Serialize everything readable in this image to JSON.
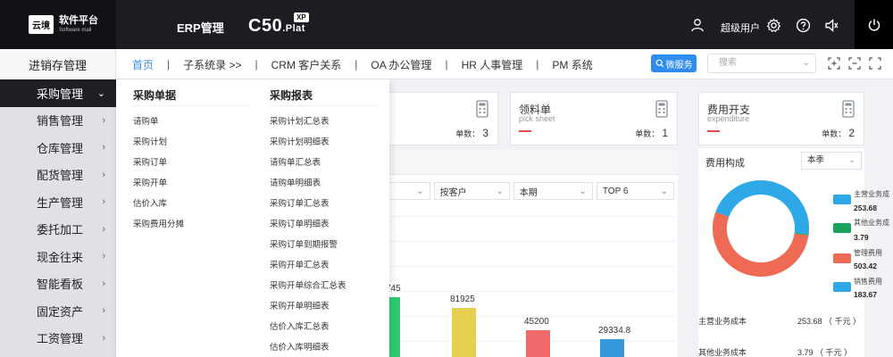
{
  "topbar": {
    "logo_badge": "云境",
    "logo_title": "软件平台",
    "logo_subtitle": "Software mall",
    "erp_label": "ERP管理",
    "product_name": "C50",
    "product_suffix": ".Plat",
    "product_badge": "XP",
    "user_label": "超级用户"
  },
  "nav": {
    "module_title": "进销存管理",
    "tabs": [
      {
        "label": "首页",
        "active": true
      },
      {
        "label": "子系统录 >>"
      },
      {
        "label": "CRM 客户关系"
      },
      {
        "label": "OA 办公管理"
      },
      {
        "label": "HR 人事管理"
      },
      {
        "label": "PM 系统"
      }
    ],
    "service_button": "微服务",
    "search_placeholder": "搜索"
  },
  "sidebar": {
    "items": [
      {
        "label": "采购管理",
        "active": true,
        "arrow": "⌄"
      },
      {
        "label": "销售管理",
        "arrow": "›"
      },
      {
        "label": "仓库管理",
        "arrow": "›"
      },
      {
        "label": "配货管理",
        "arrow": "›"
      },
      {
        "label": "生产管理",
        "arrow": "›"
      },
      {
        "label": "委托加工",
        "arrow": "›"
      },
      {
        "label": "现金往来",
        "arrow": "›"
      },
      {
        "label": "智能看板",
        "arrow": "›"
      },
      {
        "label": "固定资产",
        "arrow": "›"
      },
      {
        "label": "工资管理",
        "arrow": "›"
      }
    ]
  },
  "dropdown": {
    "col1_title": "采购单据",
    "col1_items": [
      "请购单",
      "采购计划",
      "采购订单",
      "采购开单",
      "估价入库",
      "采购费用分摊"
    ],
    "col2_title": "采购报表",
    "col2_items": [
      "采购计划汇总表",
      "采购计划明细表",
      "请购单汇总表",
      "请购单明细表",
      "采购订单汇总表",
      "采购订单明细表",
      "采购订单到期报警",
      "采购开单汇总表",
      "采购开单综合汇总表",
      "采购开单明细表",
      "估价入库汇总表",
      "估价入库明细表"
    ]
  },
  "cards": {
    "first_count_label": "单数：",
    "first_count": "3",
    "pick": {
      "title": "领料单",
      "subtitle": "pick sheet",
      "count_label": "单数：",
      "count": "1"
    },
    "expense": {
      "title": "费用开支",
      "subtitle": "expenditure",
      "count_label": "单数：",
      "count": "2"
    }
  },
  "filters": [
    {
      "label": ""
    },
    {
      "label": "按客户"
    },
    {
      "label": "本期"
    },
    {
      "label": "TOP 6"
    }
  ],
  "chart_data": {
    "type": "bar",
    "values_visible": [
      {
        "label": "745",
        "color": "#2ecc71"
      },
      {
        "label": "81925",
        "value": 81925,
        "color": "#e6cf4f"
      },
      {
        "label": "45200",
        "value": 45200,
        "color": "#ef6a6a"
      },
      {
        "label": "29334.8",
        "value": 29334.8,
        "color": "#3498db"
      }
    ]
  },
  "cost_panel": {
    "title": "费用构成",
    "period": "本季",
    "legend": [
      {
        "name": "主营业务成",
        "value": "253.68",
        "color": "#2ea8e6"
      },
      {
        "name": "其他业务成",
        "value": "3.79",
        "color": "#1aa35a"
      },
      {
        "name": "管理费用",
        "value": "503.42",
        "color": "#ef6a55"
      },
      {
        "name": "销售费用",
        "value": "183.67",
        "color": "#2ea8e6"
      }
    ],
    "donut": [
      {
        "name": "主营业务成本",
        "value": 253.68,
        "color": "#2ea8e6"
      },
      {
        "name": "其他业务成本",
        "value": 3.79,
        "color": "#1aa35a"
      },
      {
        "name": "管理费用",
        "value": 503.42,
        "color": "#ef6a55"
      },
      {
        "name": "销售费用",
        "value": 183.67,
        "color": "#2ea8e6"
      }
    ],
    "summary": [
      {
        "name": "主营业务成本",
        "value": "253.68 （ 千元 ）"
      },
      {
        "name": "其他业务成本",
        "value": "3.79 （ 千元 ）"
      }
    ]
  }
}
